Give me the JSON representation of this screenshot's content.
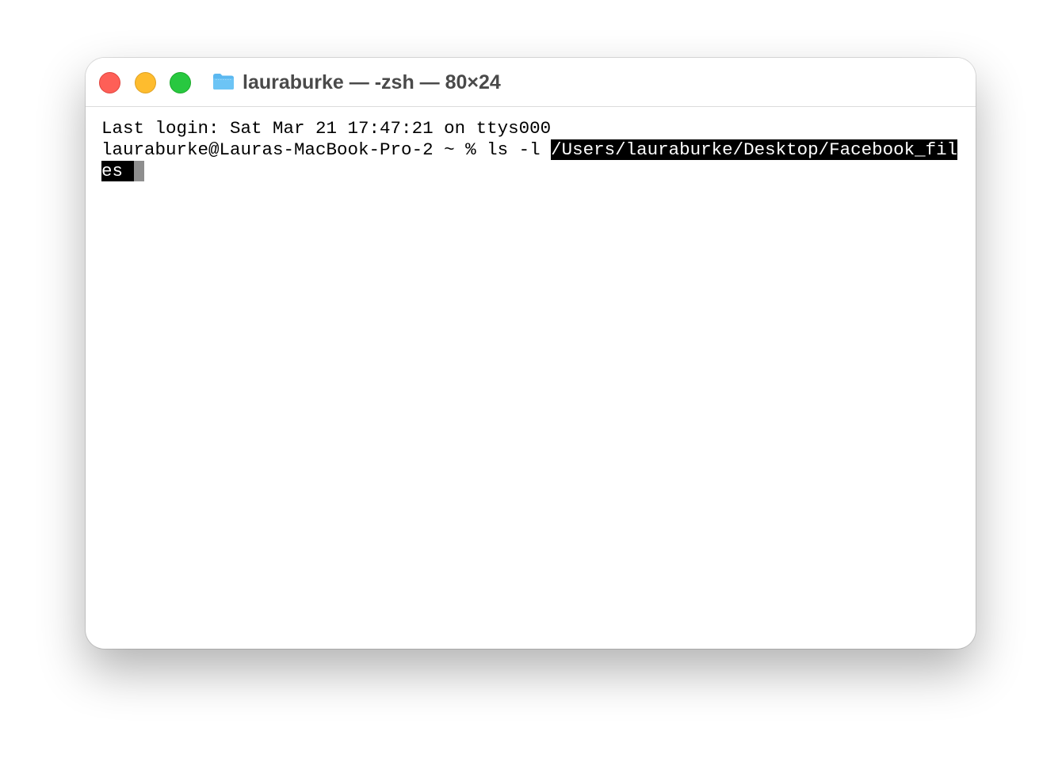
{
  "window": {
    "title": "lauraburke — -zsh — 80×24"
  },
  "icons": {
    "close": "close-button",
    "minimize": "minimize-button",
    "zoom": "zoom-button",
    "folder": "folder-icon"
  },
  "colors": {
    "close": "#fe5f57",
    "minimize": "#febc2e",
    "zoom": "#28c840",
    "folder": "#5bb8f0",
    "selection_bg": "#000000",
    "cursor": "#8e8e8e"
  },
  "terminal": {
    "last_login": "Last login: Sat Mar 21 17:47:21 on ttys000",
    "prompt": "lauraburke@Lauras-MacBook-Pro-2 ~ % ls -l ",
    "selected_path_part1": "/Users/laurabu rke/Desktop/Facebook_fil",
    "selected_path_part2": "es "
  }
}
